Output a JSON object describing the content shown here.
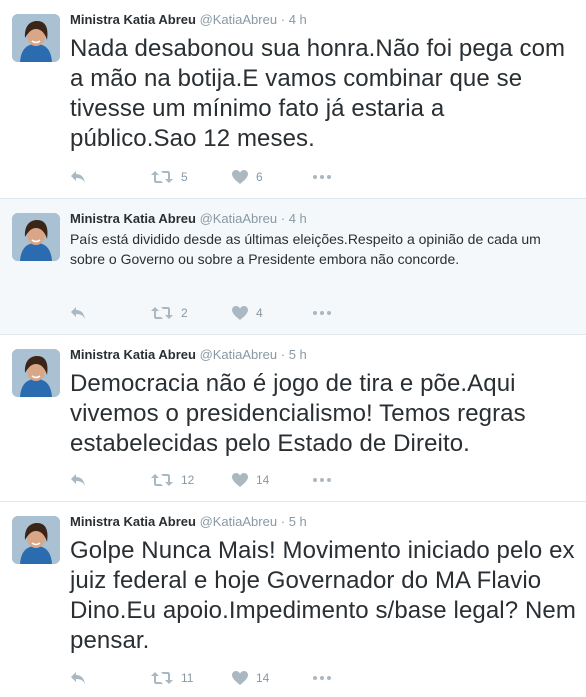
{
  "tweets": [
    {
      "name": "Ministra Katia Abreu",
      "handle": "@KatiaAbreu",
      "dot": "·",
      "time": "4 h",
      "text": "Nada desabonou sua honra.Não foi pega com a mão na botija.E vamos combinar que se tivesse um mínimo fato já estaria a público.Sao 12 meses.",
      "retweets": "5",
      "likes": "6"
    },
    {
      "name": "Ministra Katia Abreu",
      "handle": "@KatiaAbreu",
      "dot": "·",
      "time": "4 h",
      "text": "País está dividido desde as últimas eleições.Respeito a opinião de cada um sobre o Governo ou sobre a Presidente embora não concorde.",
      "retweets": "2",
      "likes": "4"
    },
    {
      "name": "Ministra Katia Abreu",
      "handle": "@KatiaAbreu",
      "dot": "·",
      "time": "5 h",
      "text": "Democracia não é jogo de tira e põe.Aqui vivemos o presidencialismo! Temos regras estabelecidas pelo Estado de Direito.",
      "retweets": "12",
      "likes": "14"
    },
    {
      "name": "Ministra Katia Abreu",
      "handle": "@KatiaAbreu",
      "dot": "·",
      "time": "5 h",
      "text": "Golpe Nunca Mais! Movimento iniciado pelo ex juiz federal e hoje Governador do MA Flavio Dino.Eu apoio.Impedimento s/base legal? Nem pensar.",
      "retweets": "11",
      "likes": "14"
    }
  ],
  "icons": {
    "reply": "reply-icon",
    "retweet": "retweet-icon",
    "like": "heart-icon",
    "more": "more-icon"
  },
  "colors": {
    "text": "#292f33",
    "muted": "#8899a6",
    "icon": "#aab8c2",
    "highlight_bg": "#f5f8fa",
    "divider": "#e1e8ed"
  }
}
